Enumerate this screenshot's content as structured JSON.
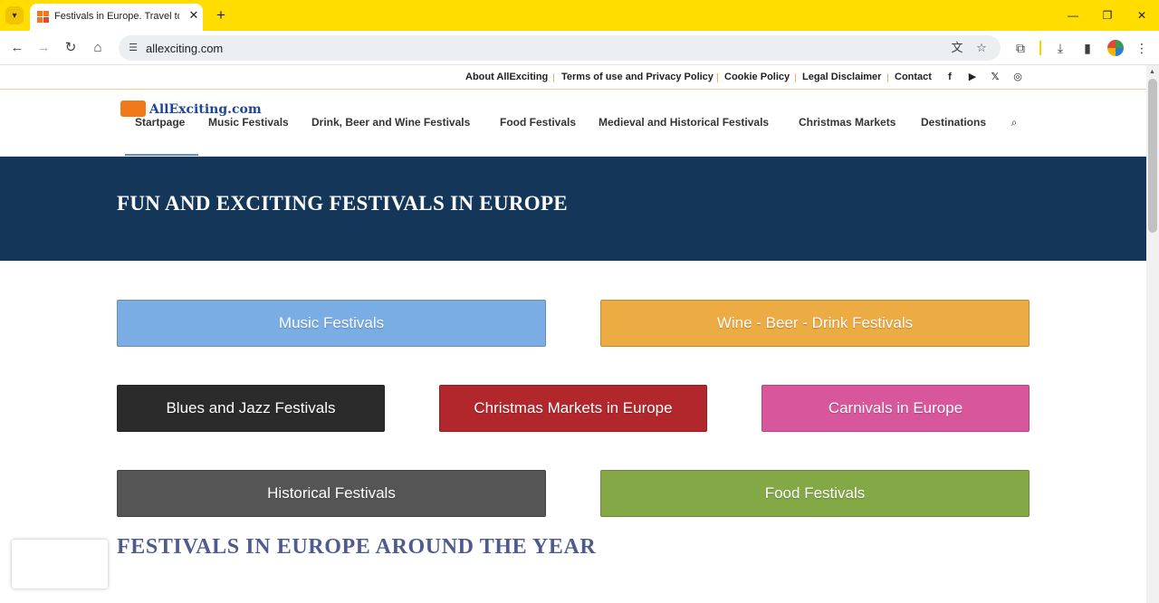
{
  "browser": {
    "tab_title": "Festivals in Europe. Travel to E",
    "url": "allexciting.com",
    "icons": {
      "tab_list": "chevron-down-icon",
      "close": "close-icon",
      "new_tab": "plus-icon",
      "minimize": "minimize-icon",
      "restore": "restore-icon",
      "close_window": "close-window-icon",
      "back": "back-arrow-icon",
      "forward": "forward-arrow-icon",
      "reload": "reload-icon",
      "home": "home-icon",
      "site_info": "tune-icon",
      "translate": "translate-icon",
      "bookmark": "star-icon",
      "extensions": "puzzle-icon",
      "downloads": "download-icon",
      "side_panel": "side-panel-icon",
      "menu": "kebab-menu-icon"
    }
  },
  "topbar": {
    "links": [
      "About AllExciting",
      "Terms of use and Privacy Policy",
      "Cookie Policy",
      "Legal Disclaimer",
      "Contact"
    ],
    "social": [
      "facebook-icon",
      "youtube-icon",
      "x-icon",
      "instagram-icon"
    ]
  },
  "header": {
    "logo_text": "AllExciting.com",
    "nav": [
      "Startpage",
      "Music Festivals",
      "Drink, Beer and Wine Festivals",
      "Food Festivals",
      "Medieval and Historical Festivals",
      "Christmas Markets",
      "Destinations"
    ],
    "active_nav": "Startpage"
  },
  "hero": {
    "title": "FUN AND EXCITING FESTIVALS IN EUROPE"
  },
  "categories": [
    {
      "label": "Music Festivals",
      "color": "#7aade3"
    },
    {
      "label": "Wine - Beer - Drink Festivals",
      "color": "#ecab43"
    },
    {
      "label": "Blues and Jazz Festivals",
      "color": "#2b2b2b"
    },
    {
      "label": "Christmas Markets in Europe",
      "color": "#b1272c"
    },
    {
      "label": "Carnivals in Europe",
      "color": "#d8579c"
    },
    {
      "label": "Historical Festivals",
      "color": "#555555"
    },
    {
      "label": "Food Festivals",
      "color": "#84a846"
    }
  ],
  "section": {
    "title": "FESTIVALS IN EUROPE AROUND THE YEAR"
  },
  "colors": {
    "chrome_accent": "#ffdd00",
    "hero_bg": "#143659",
    "section_title": "#4f5b8f"
  }
}
